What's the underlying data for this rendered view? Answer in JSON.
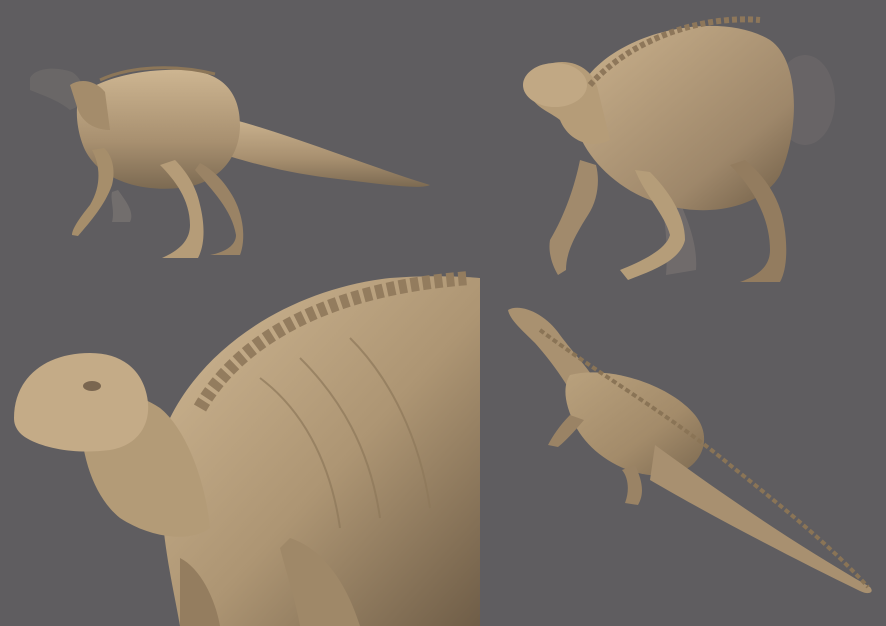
{
  "image": {
    "colors": {
      "background": "#5f5d60",
      "skin_light": "#c8b08c",
      "skin_mid": "#a68e6b",
      "skin_dark": "#6e5c45",
      "ghost": "#777270"
    },
    "panels": [
      {
        "view": "side"
      },
      {
        "view": "front-three-quarter"
      },
      {
        "view": "closeup"
      },
      {
        "view": "top-down"
      }
    ]
  }
}
